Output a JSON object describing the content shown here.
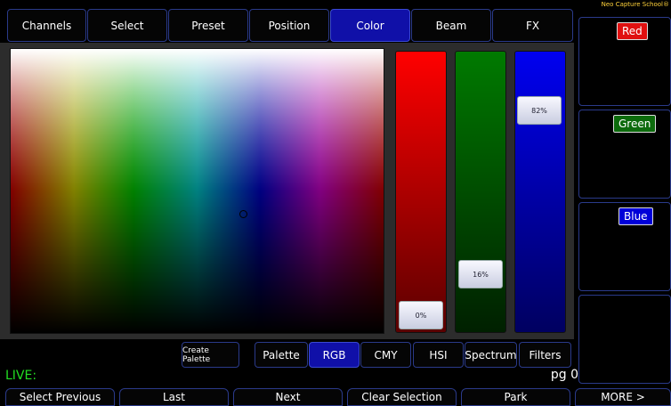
{
  "tabs": [
    "Channels",
    "Select",
    "Preset",
    "Position",
    "Color",
    "Beam",
    "FX"
  ],
  "active_tab": "Color",
  "sliders": {
    "red": {
      "label": "0%",
      "value": 0
    },
    "green": {
      "label": "16%",
      "value": 16
    },
    "blue": {
      "label": "82%",
      "value": 82
    }
  },
  "colors": {
    "accent_blue": "#1010a8",
    "red": "#ff0000",
    "green": "#007a00",
    "blue": "#0000f0"
  },
  "toolbar": {
    "create_palette": "Create Palette",
    "modes": [
      "Palette",
      "RGB",
      "CMY",
      "HSI",
      "Spectrum",
      "Filters"
    ],
    "active_mode": "RGB"
  },
  "status": {
    "live": "LIVE:",
    "page": "pg 0"
  },
  "brand": "Neo Capture School®",
  "side": {
    "red": "Red",
    "green": "Green",
    "blue": "Blue"
  },
  "bottom": [
    "Select Previous",
    "Last",
    "Next",
    "Clear Selection",
    "Park",
    "MORE >"
  ]
}
